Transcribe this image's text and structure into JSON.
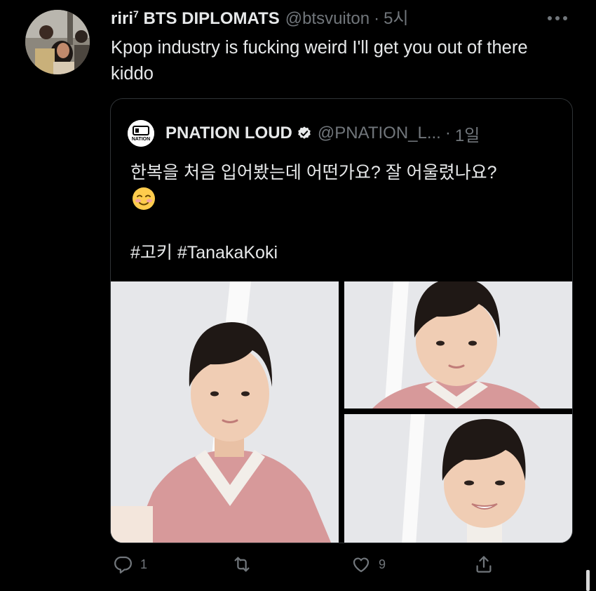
{
  "tweet": {
    "author_name": "riri",
    "author_sup": "7",
    "author_suffix": " BTS DIPLOMATS",
    "handle": "@btsvuiton",
    "dot": "·",
    "time": "5시",
    "text": "Kpop industry is fucking weird I'll get you out of there kiddo"
  },
  "quote": {
    "logo_text": "NATION",
    "name": "PNATION LOUD",
    "handle": "@PNATION_L...",
    "dot": "·",
    "time": "1일",
    "text": "한복을 처음 입어봤는데 어떤가요? 잘 어울렸나요?",
    "emoji": "☺️",
    "hashtags": "#고키 #TanakaKoki"
  },
  "actions": {
    "reply_count": "1",
    "retweet_count": "",
    "like_count": "9"
  },
  "icons": [
    "more-icon",
    "verified-icon",
    "reply-icon",
    "retweet-icon",
    "like-icon",
    "share-icon"
  ],
  "colors": {
    "background": "#000000",
    "text": "#e7e9ea",
    "secondary": "#71767b",
    "border": "#2f3336",
    "hanbok_pink": "#d99a9b"
  }
}
